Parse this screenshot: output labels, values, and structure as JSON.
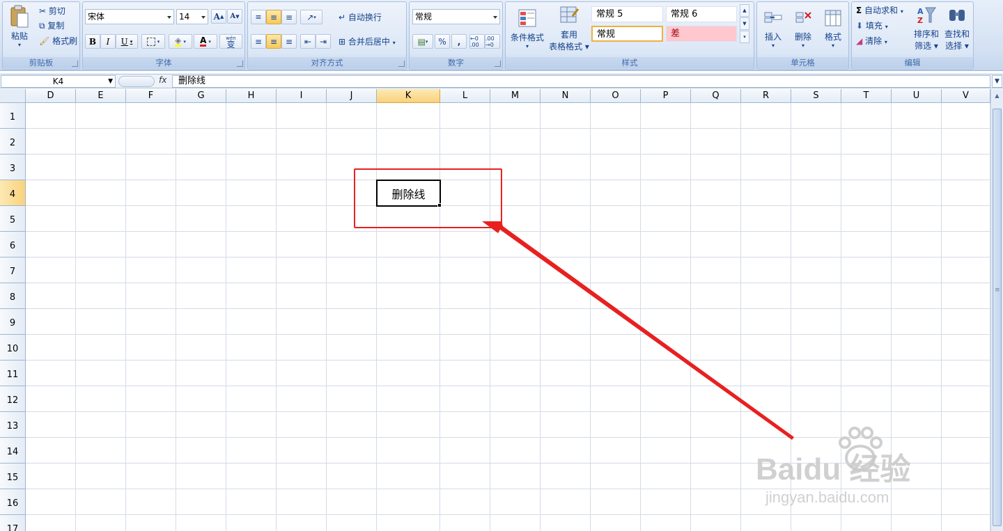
{
  "clipboard": {
    "paste": "粘贴",
    "cut": "剪切",
    "copy": "复制",
    "format_painter": "格式刷",
    "title": "剪贴板"
  },
  "font": {
    "name": "宋体",
    "size": "14",
    "grow": "A",
    "shrink": "A",
    "bold": "B",
    "italic": "I",
    "underline": "U",
    "font_color": "A",
    "phonetic": "wén",
    "phonetic2": "变",
    "title": "字体"
  },
  "alignment": {
    "wrap": "自动换行",
    "merge": "合并后居中",
    "title": "对齐方式"
  },
  "number": {
    "format": "常规",
    "percent": "%",
    "comma": ",",
    "inc_dec": "←0 .00",
    "dec_dec": ".00 →0",
    "title": "数字"
  },
  "styles": {
    "cond_format": "条件格式",
    "table_format_1": "套用",
    "table_format_2": "表格格式",
    "cells": [
      "常规 5",
      "常规 6",
      "常规",
      "差"
    ],
    "title": "样式"
  },
  "cells": {
    "insert": "插入",
    "delete": "删除",
    "format": "格式",
    "title": "单元格"
  },
  "editing": {
    "autosum": "自动求和",
    "fill": "填充",
    "clear": "清除",
    "sort_1": "排序和",
    "sort_2": "筛选",
    "find_1": "查找和",
    "find_2": "选择",
    "title": "编辑"
  },
  "formula_bar": {
    "name_box": "K4",
    "fx": "fx",
    "content": "删除线"
  },
  "columns": [
    "D",
    "E",
    "F",
    "G",
    "H",
    "I",
    "J",
    "K",
    "L",
    "M",
    "N",
    "O",
    "P",
    "Q",
    "R",
    "S",
    "T",
    "U",
    "V"
  ],
  "selected_column": "K",
  "rows": [
    "1",
    "2",
    "3",
    "4",
    "5",
    "6",
    "7",
    "8",
    "9",
    "10",
    "11",
    "12",
    "13",
    "14",
    "15",
    "16",
    "17"
  ],
  "selected_row": "4",
  "active_cell": {
    "ref": "K4",
    "value": "删除线"
  },
  "watermark": {
    "logo": "Baidu 经验",
    "url": "jingyan.baidu.com"
  },
  "colors": {
    "annotation": "#e82020",
    "selected_header": "#f9d27c",
    "bad_style_bg": "#ffc7ce",
    "bad_style_text": "#9c0006"
  }
}
